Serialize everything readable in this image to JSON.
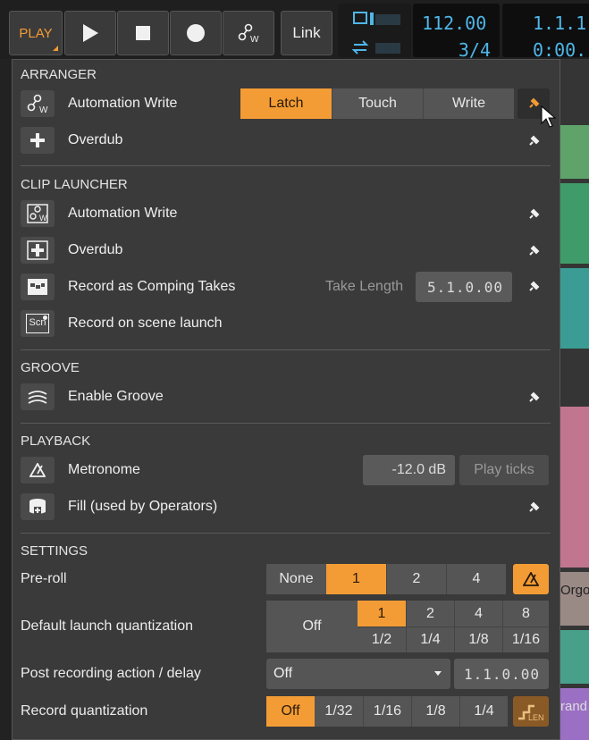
{
  "transport": {
    "play_label": "PLAY",
    "link_label": "Link",
    "tempo": "112.00",
    "time_signature": "3/4",
    "position": "1.1.1",
    "time": "0:00."
  },
  "arranger": {
    "title": "ARRANGER",
    "automation_write_label": "Automation Write",
    "modes": [
      "Latch",
      "Touch",
      "Write"
    ],
    "active_mode": "Latch",
    "overdub_label": "Overdub"
  },
  "clip_launcher": {
    "title": "CLIP LAUNCHER",
    "automation_write_label": "Automation Write",
    "overdub_label": "Overdub",
    "comping_label": "Record as Comping Takes",
    "take_length_label": "Take Length",
    "take_length_value": "5.1.0.00",
    "scene_launch_label": "Record on scene launch",
    "scene_icon_text": "Scn"
  },
  "groove": {
    "title": "GROOVE",
    "enable_label": "Enable Groove"
  },
  "playback": {
    "title": "PLAYBACK",
    "metronome_label": "Metronome",
    "metronome_volume": "-12.0 dB",
    "play_ticks_label": "Play ticks",
    "fill_label": "Fill (used by Operators)"
  },
  "settings": {
    "title": "SETTINGS",
    "preroll_label": "Pre-roll",
    "preroll_options": [
      "None",
      "1",
      "2",
      "4"
    ],
    "preroll_active": "1",
    "launch_q_label": "Default launch quantization",
    "launch_q_off": "Off",
    "launch_q_top": [
      "1",
      "2",
      "4",
      "8"
    ],
    "launch_q_bottom": [
      "1/2",
      "1/4",
      "1/8",
      "1/16"
    ],
    "launch_q_active": "1",
    "post_rec_label": "Post recording action / delay",
    "post_rec_value": "Off",
    "post_rec_delay": "1.1.0.00",
    "rec_q_label": "Record quantization",
    "rec_q_options": [
      "Off",
      "1/32",
      "1/16",
      "1/8",
      "1/4"
    ],
    "rec_q_active": "Off",
    "len_label": "LEN"
  },
  "background": {
    "right_strip_texts": [
      "Orgo",
      "rand"
    ]
  },
  "colors": {
    "accent": "#f39c35",
    "lcd": "#4fb6e8",
    "panel": "#3a3a3a"
  }
}
